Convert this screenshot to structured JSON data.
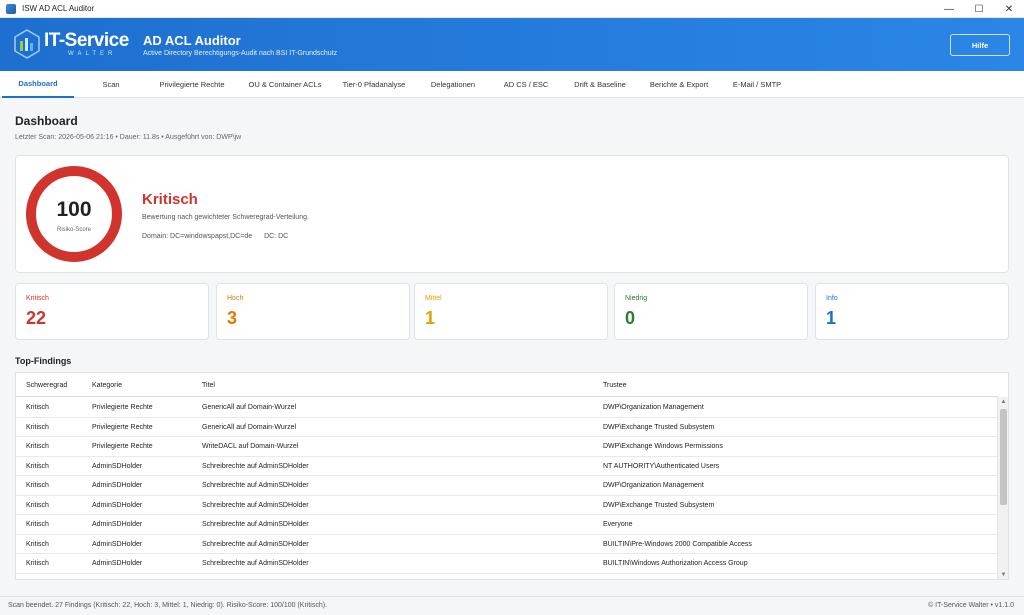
{
  "window": {
    "title": "ISW AD ACL Auditor",
    "controls": [
      "—",
      "☐",
      "✕"
    ]
  },
  "header": {
    "logo_text": "IT-Service",
    "logo_sub": "WALTER",
    "title": "AD ACL Auditor",
    "subtitle": "Active Directory Berechtigungs-Audit nach BSI IT-Grundschutz",
    "help_label": "Hilfe",
    "colors": {
      "start": "#1e6fcf",
      "end": "#2b86e6"
    }
  },
  "tabs": [
    {
      "label": "Dashboard",
      "active": true
    },
    {
      "label": "Scan"
    },
    {
      "label": "Privilegierte Rechte"
    },
    {
      "label": "OU & Container ACLs"
    },
    {
      "label": "Tier-0 Pfadanalyse"
    },
    {
      "label": "Delegationen"
    },
    {
      "label": "AD CS / ESC"
    },
    {
      "label": "Drift & Baseline"
    },
    {
      "label": "Berichte & Export"
    },
    {
      "label": "E-Mail / SMTP"
    }
  ],
  "dashboard": {
    "title": "Dashboard",
    "last_scan": "Letzter Scan: 2026-05-06 21:16 • Dauer: 11.8s • Ausgeführt von: DWP\\jw",
    "score": {
      "value": "100",
      "label": "Risiko-Score",
      "level": "Kritisch",
      "description": "Bewertung nach gewichteter Schweregrad-Verteilung.",
      "domain": "Domain: DC=windowspapst,DC=de",
      "dc": "DC: DC",
      "ring_color": "#d0342c",
      "fill_fraction": 1.0
    },
    "stats": [
      {
        "label": "Kritisch",
        "value": "22",
        "color": "#d0342c"
      },
      {
        "label": "Hoch",
        "value": "3",
        "color": "#e07b00"
      },
      {
        "label": "Mittel",
        "value": "1",
        "color": "#e6a100"
      },
      {
        "label": "Niedrig",
        "value": "0",
        "color": "#2e7d32"
      },
      {
        "label": "Info",
        "value": "1",
        "color": "#1a6fd1"
      }
    ]
  },
  "findings": {
    "title": "Top-Findings",
    "columns": [
      "Schweregrad",
      "Kategorie",
      "Titel",
      "Trustee"
    ],
    "rows": [
      [
        "Kritisch",
        "Privilegierte Rechte",
        "GenericAll auf Domain-Wurzel",
        "DWP\\Organization Management"
      ],
      [
        "Kritisch",
        "Privilegierte Rechte",
        "GenericAll auf Domain-Wurzel",
        "DWP\\Exchange Trusted Subsystem"
      ],
      [
        "Kritisch",
        "Privilegierte Rechte",
        "WriteDACL auf Domain-Wurzel",
        "DWP\\Exchange Windows Permissions"
      ],
      [
        "Kritisch",
        "AdminSDHolder",
        "Schreibrechte auf AdminSDHolder",
        "NT AUTHORITY\\Authenticated Users"
      ],
      [
        "Kritisch",
        "AdminSDHolder",
        "Schreibrechte auf AdminSDHolder",
        "DWP\\Organization Management"
      ],
      [
        "Kritisch",
        "AdminSDHolder",
        "Schreibrechte auf AdminSDHolder",
        "DWP\\Exchange Trusted Subsystem"
      ],
      [
        "Kritisch",
        "AdminSDHolder",
        "Schreibrechte auf AdminSDHolder",
        "Everyone"
      ],
      [
        "Kritisch",
        "AdminSDHolder",
        "Schreibrechte auf AdminSDHolder",
        "BUILTIN\\Pre-Windows 2000 Compatible Access"
      ],
      [
        "Kritisch",
        "AdminSDHolder",
        "Schreibrechte auf AdminSDHolder",
        "BUILTIN\\Windows Authorization Access Group"
      ]
    ]
  },
  "statusbar": {
    "left": "Scan beendet. 27 Findings (Kritisch: 22, Hoch: 3, Mittel: 1, Niedrig: 0). Risiko-Score: 100/100 (Kritisch).",
    "right": "© IT-Service Walter • v1.1.0"
  }
}
